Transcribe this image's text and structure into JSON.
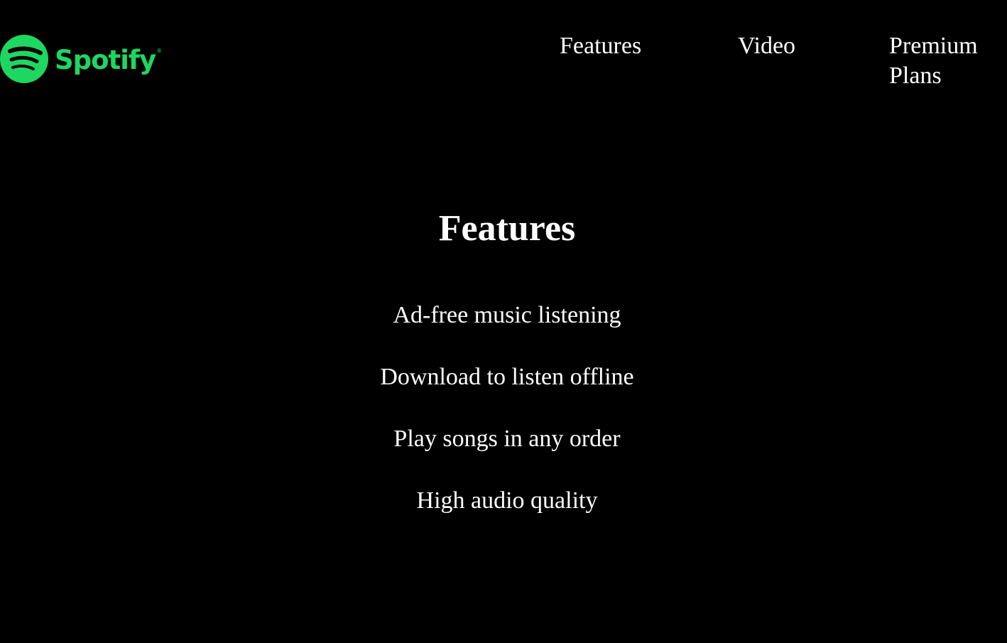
{
  "brand": {
    "name": "Spotify",
    "registered_mark": "®",
    "color": "#1ed760",
    "icon": "spotify-logo-icon"
  },
  "nav": {
    "items": [
      {
        "label": "Features"
      },
      {
        "label": "Video"
      },
      {
        "label": "Premium Plans"
      }
    ]
  },
  "features": {
    "heading": "Features",
    "items": [
      "Ad-free music listening",
      "Download to listen offline",
      "Play songs in any order",
      "High audio quality"
    ]
  },
  "colors": {
    "background": "#000000",
    "text": "#ffffff"
  }
}
